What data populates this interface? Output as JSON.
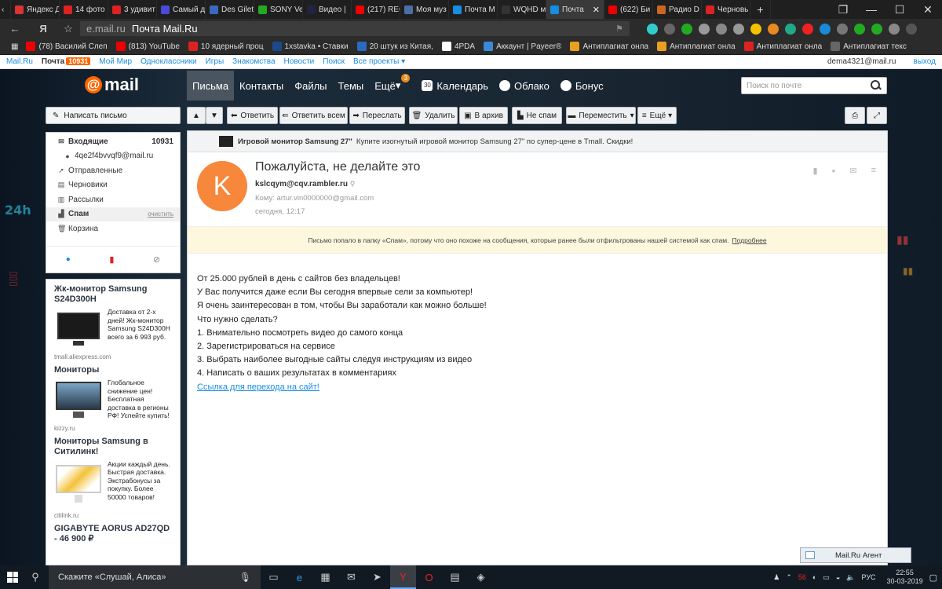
{
  "browser": {
    "tabs": [
      {
        "label": "Яндекс Д",
        "color": "#d33"
      },
      {
        "label": "14 фото",
        "color": "#d22"
      },
      {
        "label": "3 удивит",
        "color": "#d22"
      },
      {
        "label": "Самый д",
        "color": "#4a4ad8"
      },
      {
        "label": "Des Gilet",
        "color": "#3a6ac0"
      },
      {
        "label": "SONY Ve",
        "color": "#2a2"
      },
      {
        "label": "Видео |",
        "color": "#224"
      },
      {
        "label": "(217) REC",
        "color": "#e00"
      },
      {
        "label": "Моя муз",
        "color": "#4a6ea8"
      },
      {
        "label": "Почта М",
        "color": "#168de2"
      },
      {
        "label": "WQHD м",
        "color": "#333"
      },
      {
        "label": "Почта",
        "color": "#168de2",
        "active": true
      },
      {
        "label": "(622) Би",
        "color": "#e00"
      },
      {
        "label": "Радио D",
        "color": "#c62"
      },
      {
        "label": "Черновь",
        "color": "#d22"
      }
    ],
    "new_tab": "+",
    "address": {
      "host": "e.mail.ru",
      "title": "Почта Mail.Ru"
    },
    "bookmarks": [
      {
        "label": "(78) Василий Слеп",
        "color": "#e00"
      },
      {
        "label": "(813) YouTube",
        "color": "#e00"
      },
      {
        "label": "10 ядерный проц",
        "color": "#d22"
      },
      {
        "label": "1xstavka • Ставки",
        "color": "#1a4a8a"
      },
      {
        "label": "20 штук из Китая,",
        "color": "#2a6ac0"
      },
      {
        "label": "4PDA",
        "color": "#fff"
      },
      {
        "label": "Аккаунт | Payeer®",
        "color": "#3a8ad8"
      },
      {
        "label": "Антиплагиат онла",
        "color": "#e8a020"
      },
      {
        "label": "Антиплагиат онла",
        "color": "#e8a020"
      },
      {
        "label": "Антиплагиат онла",
        "color": "#d22"
      },
      {
        "label": "Антиплагиат текс",
        "color": "#666"
      }
    ]
  },
  "portal": {
    "links": [
      "Mail.Ru",
      "Почта",
      "Мой Мир",
      "Одноклассники",
      "Игры",
      "Знакомства",
      "Новости",
      "Поиск",
      "Все проекты"
    ],
    "mail_count": "10931",
    "user": "dema4321@mail.ru",
    "logout": "выход"
  },
  "header": {
    "logo": "mail",
    "nav": [
      "Письма",
      "Контакты",
      "Файлы",
      "Темы",
      "Ещё",
      "Календарь",
      "Облако",
      "Бонус"
    ],
    "more_badge": "3",
    "calendar_day": "30",
    "search_placeholder": "Поиск по почте"
  },
  "toolbar": {
    "compose": "Написать письмо",
    "reply": "Ответить",
    "reply_all": "Ответить всем",
    "forward": "Переслать",
    "delete": "Удалить",
    "archive": "В архив",
    "not_spam": "Не спам",
    "move": "Переместить",
    "more": "Ещё"
  },
  "folders": {
    "inbox": "Входящие",
    "inbox_count": "10931",
    "inbox_sub": "4qe2f4bvvqf9@mail.ru",
    "sent": "Отправленные",
    "drafts": "Черновики",
    "newsletters": "Рассылки",
    "spam": "Спам",
    "clean": "очистить",
    "trash": "Корзина"
  },
  "ads": [
    {
      "title": "Жк-монитор Samsung S24D300H",
      "text": "Доставка от 2-х дней! Жк-монитор Samsung S24D300H всего за 6 993 руб.",
      "source": "tmall.aliexpress.com"
    },
    {
      "title": "Мониторы",
      "text": "Глобальное снижение цен! Бесплатная доставка в регионы РФ! Успейте купить!",
      "source": "kizzy.ru"
    },
    {
      "title": "Мониторы Samsung в Ситилинк!",
      "text": "Акции каждый день. Быстрая доставка. Экстрабонусы за покупку. Более 50000 товаров!",
      "source": "citilink.ru"
    },
    {
      "title": "GIGABYTE AORUS AD27QD - 46 900 ₽",
      "text": "",
      "source": ""
    }
  ],
  "banner": {
    "title": "Игровой монитор Samsung 27\"",
    "text": "Купите изогнутый игровой монитор Samsung 27\" по супер-цене в Tmall. Скидки!"
  },
  "message": {
    "avatar_letter": "K",
    "subject": "Пожалуйста, не делайте это",
    "from": "kslcqym@cqv.rambler.ru",
    "to": "Кому: artur.vin0000000@gmail.com",
    "date": "сегодня, 12:17",
    "spam_notice": "Письмо попало в папку «Спам», потому что оно похоже на сообщения, которые ранее были отфильтрованы нашей системой как спам.",
    "spam_more": "Подробнее",
    "body": [
      "От 25.000 рублей в день с сайтов без владельцев!",
      "У Вас получится даже если Вы сегодня впервые сели за компьютер!",
      "Я очень заинтересован в том, чтобы Вы заработали как можно больше!",
      "Что нужно сделать?",
      "1. Внимательно посмотреть видео до самого конца",
      "2. Зарегистрироваться на сервисе",
      "3. Выбрать наиболее выгодные сайты следуя инструкциям из видео",
      "4. Написать о ваших результатах в комментариях"
    ],
    "link": "Ссылка для перехода на сайт!"
  },
  "agent": "Mail.Ru Агент",
  "taskbar": {
    "search": "Скажите «Слушай, Алиса»",
    "tray_badge": "56",
    "lang": "РУС",
    "time": "22:55",
    "date": "30-03-2019"
  }
}
